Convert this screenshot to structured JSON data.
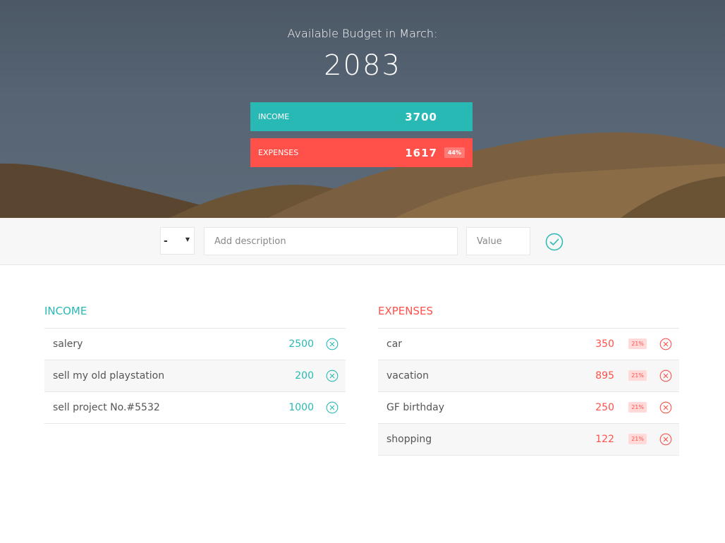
{
  "header": {
    "budget_title": "Available Budget in March:",
    "budget_value": "2083",
    "income": {
      "label": "INCOME",
      "value": "3700"
    },
    "expenses": {
      "label": "EXPENSES",
      "value": "1617",
      "percentage": "44%"
    }
  },
  "add_form": {
    "type_value": "-",
    "description_placeholder": "Add description",
    "value_placeholder": "Value"
  },
  "income": {
    "title": "INCOME",
    "items": [
      {
        "description": "salery",
        "value": "2500"
      },
      {
        "description": "sell my old playstation",
        "value": "200"
      },
      {
        "description": "sell project No.#5532",
        "value": "1000"
      }
    ]
  },
  "expenses": {
    "title": "EXPENSES",
    "items": [
      {
        "description": "car",
        "value": "350",
        "percentage": "21%"
      },
      {
        "description": "vacation",
        "value": "895",
        "percentage": "21%"
      },
      {
        "description": "GF birthday",
        "value": "250",
        "percentage": "21%"
      },
      {
        "description": "shopping",
        "value": "122",
        "percentage": "21%"
      }
    ]
  },
  "colors": {
    "income": "#28b9b5",
    "expenses": "#ff5049"
  }
}
